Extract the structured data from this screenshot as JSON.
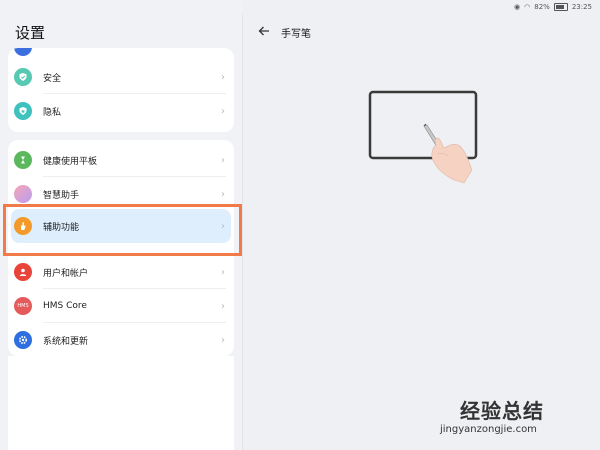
{
  "status_bar": {
    "battery": "82%",
    "time": "23:25"
  },
  "settings": {
    "title": "设置",
    "group1": [
      {
        "label": "安全",
        "icon": "shield-icon"
      },
      {
        "label": "隐私",
        "icon": "privacy-icon"
      }
    ],
    "group2": [
      {
        "label": "健康使用平板",
        "icon": "hourglass-icon"
      },
      {
        "label": "智慧助手",
        "icon": "assistant-icon"
      },
      {
        "label": "辅助功能",
        "icon": "hand-icon",
        "selected": true
      },
      {
        "label": "用户和帐户",
        "icon": "user-icon"
      },
      {
        "label": "HMS Core",
        "icon": "hms-icon",
        "icon_text": "HMS"
      },
      {
        "label": "系统和更新",
        "icon": "gear-icon"
      }
    ]
  },
  "detail": {
    "title": "手写笔"
  },
  "watermark": {
    "cn": "经验总结",
    "url": "jingyanzongjie.com"
  },
  "colors": {
    "highlight_border": "#f07a48",
    "selected_row": "#dfeefd"
  }
}
